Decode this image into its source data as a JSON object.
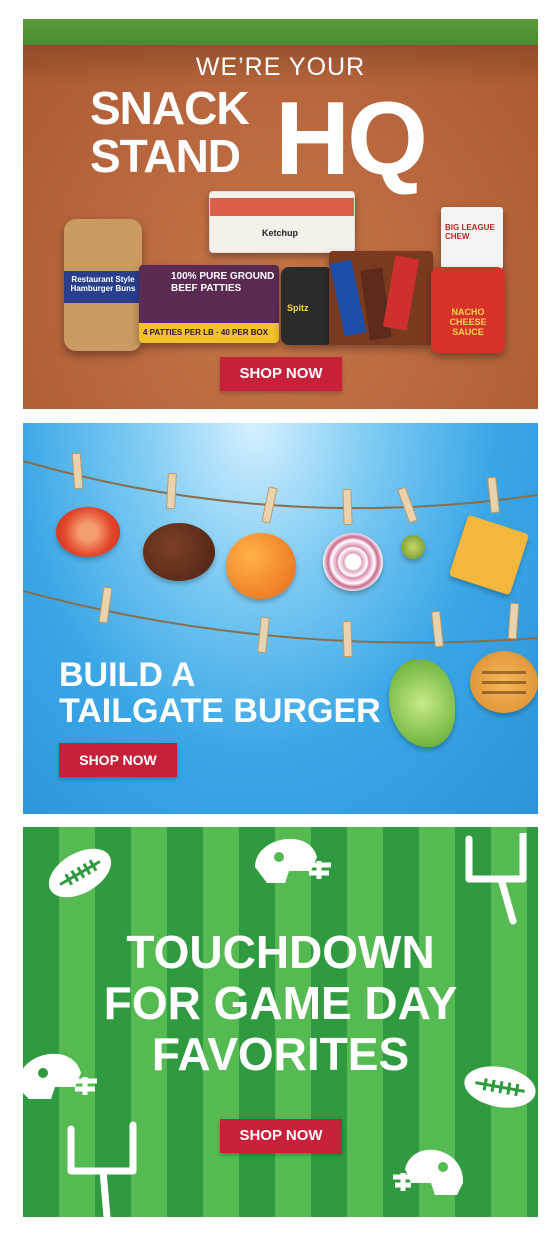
{
  "banner_snack": {
    "pre_title": "WE’RE YOUR",
    "line1": "SNACK",
    "line2": "STAND",
    "big": "HQ",
    "button": "SHOP NOW",
    "products": {
      "ketchup": "Ketchup",
      "buns": "Restaurant Style Hamburger Buns",
      "patties": "100% PURE GROUND BEEF PATTIES",
      "patties_sub": "4 PATTIES PER LB · 40 PER BOX",
      "spitz": "Spitz",
      "gum": "BIG LEAGUE CHEW",
      "nacho": "NACHO CHEESE SAUCE"
    }
  },
  "banner_burger": {
    "title_line1": "BUILD A",
    "title_line2": "TAILGATE BURGER",
    "button": "SHOP NOW"
  },
  "banner_touchdown": {
    "title_line1": "TOUCHDOWN",
    "title_line2": "FOR GAME DAY",
    "title_line3": "FAVORITES",
    "button": "SHOP NOW"
  },
  "colors": {
    "button_red": "#c6203b",
    "dirt": "#b9683f",
    "sky": "#3aa6e6",
    "turf_dark": "#2f9a3f",
    "turf_light": "#56ba53"
  },
  "icons": [
    "football-icon",
    "helmet-icon",
    "goalpost-icon"
  ]
}
